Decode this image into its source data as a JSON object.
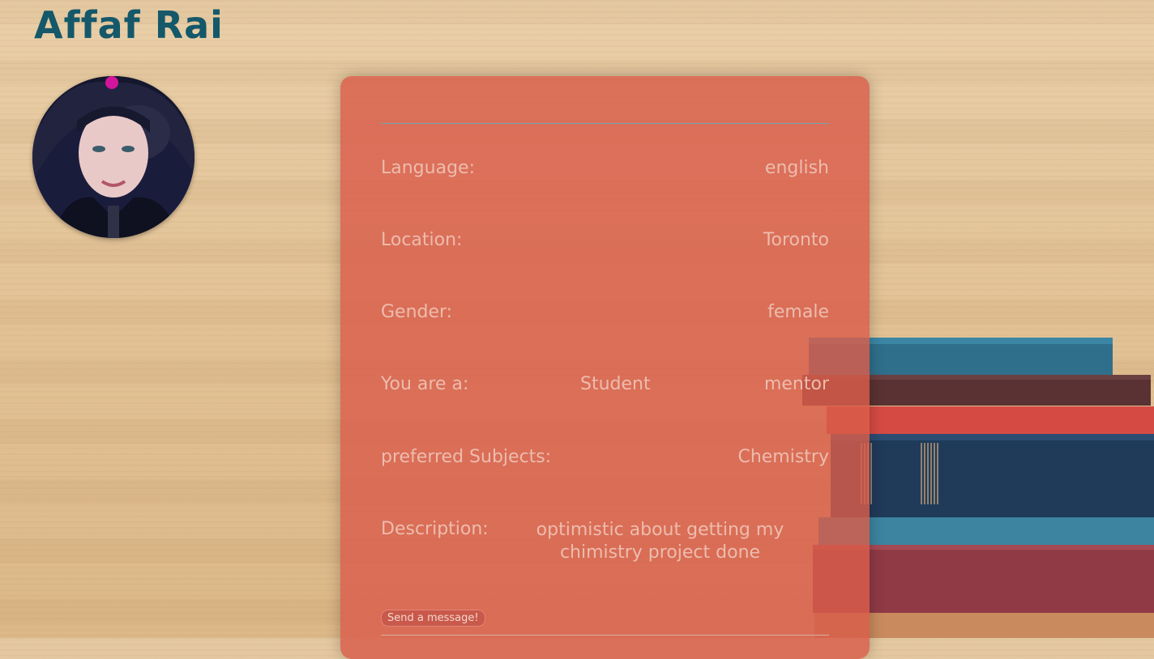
{
  "profile": {
    "name": "Affaf Rai",
    "fields": {
      "language": {
        "label": "Language:",
        "value": "english"
      },
      "location": {
        "label": "Location:",
        "value": "Toronto"
      },
      "gender": {
        "label": "Gender:",
        "value": "female"
      },
      "role": {
        "label": "You are a:",
        "option_a": "Student",
        "option_b": "mentor"
      },
      "subjects": {
        "label": "preferred Subjects:",
        "value": "Chemistry"
      },
      "description": {
        "label": "Description:",
        "value": "optimistic about getting my chimistry project done"
      }
    },
    "send_button_label": "Send a message!"
  },
  "icons": {
    "avatar": "user-photo",
    "background_decoration": "stack-of-books"
  },
  "colors": {
    "title": "#14586a",
    "card": "#d95d4b",
    "card_text": "#edbcae",
    "divider": "#6fa6b4"
  }
}
